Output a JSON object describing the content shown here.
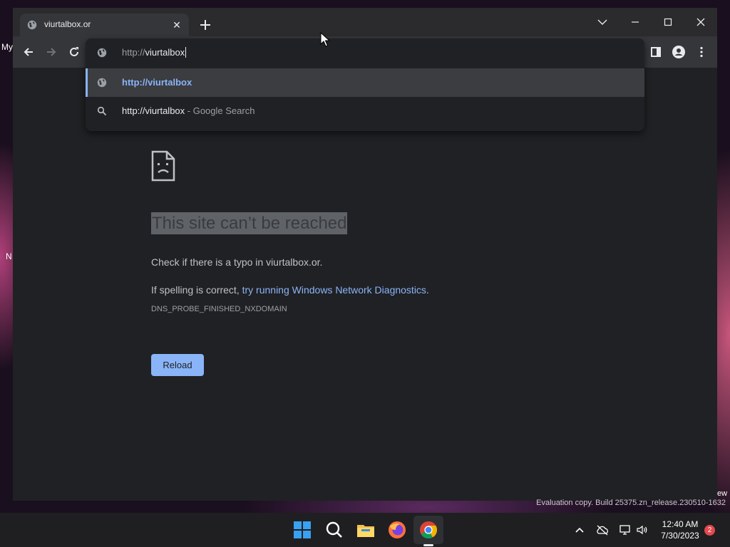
{
  "browser": {
    "tab": {
      "title": "viurtalbox.or"
    },
    "omnibox": {
      "scheme": "http://",
      "typed": "viurtalbox",
      "suggestions": [
        {
          "text": "http://viurtalbox",
          "suffix": ""
        },
        {
          "text": "http://viurtalbox",
          "suffix": " - Google Search"
        }
      ]
    }
  },
  "error_page": {
    "title": "This site can’t be reached",
    "line1": "Check if there is a typo in viurtalbox.or.",
    "line2_prefix": "If spelling is correct, ",
    "line2_link": "try running Windows Network Diagnostics",
    "line2_suffix": ".",
    "code": "DNS_PROBE_FINISHED_NXDOMAIN",
    "reload_label": "Reload"
  },
  "desktop": {
    "frag_my": "My",
    "frag_n": "N",
    "frag_ew": "ew",
    "watermark": "Evaluation copy. Build 25375.zn_release.230510-1632"
  },
  "taskbar": {
    "time": "12:40 AM",
    "date": "7/30/2023",
    "notification_count": "2"
  },
  "colors": {
    "accent": "#8ab4f8",
    "page_bg": "#202124",
    "toolbar_bg": "#35363a"
  }
}
